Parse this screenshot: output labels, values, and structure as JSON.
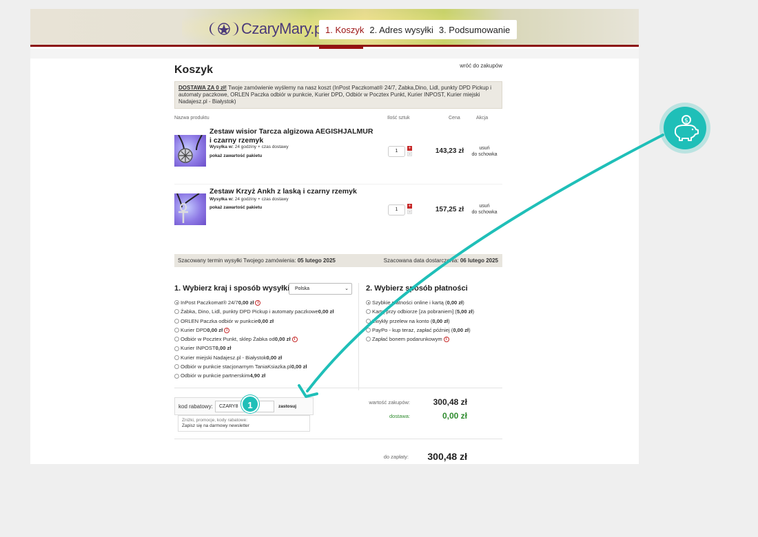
{
  "header": {
    "logo_text": "CzaryMary.pl",
    "steps": [
      "1. Koszyk",
      "2. Adres wysyłki",
      "3. Podsumowanie"
    ]
  },
  "cart": {
    "title": "Koszyk",
    "back_link": "wróć do zakupów",
    "shipping_note_bold": "DOSTAWA ZA 0 zł!",
    "shipping_note": " Twoje zamówienie wyślemy na nasz koszt (InPost Paczkomat® 24/7, Żabka,Dino, Lidl, punkty DPD Pickup i automaty paczkowe, ORLEN Paczka odbiór w punkcie, Kurier DPD, Odbiór w Pocztex Punkt, Kurier INPOST, Kurier miejski Nadajesz.pl - Białystok)",
    "columns": {
      "name": "Nazwa produktu",
      "qty": "Ilość sztuk",
      "price": "Cena",
      "action": "Akcja"
    },
    "items": [
      {
        "name": "Zestaw wisior Tarcza algizowa AEGISHJALMUR i czarny rzemyk",
        "ship_label": "Wysyłka w:",
        "ship_value": " 24 godziny + czas dostawy",
        "pack": "pokaż zawartość pakietu",
        "qty": "1",
        "price": "143,23 zł",
        "remove": "usuń",
        "save": "do schowka"
      },
      {
        "name": "Zestaw Krzyż Ankh z laską i czarny rzemyk",
        "ship_label": "Wysyłka w:",
        "ship_value": " 24 godziny + czas dostawy",
        "pack": "pokaż zawartość pakietu",
        "qty": "1",
        "price": "157,25 zł",
        "remove": "usuń",
        "save": "do schowka"
      }
    ],
    "dispatch_label": "Szacowany termin wysyłki Twojego zamówienia: ",
    "dispatch_date": "05 lutego 2025",
    "delivery_label": "Szacowana data dostarczenia: ",
    "delivery_date": "06 lutego 2025"
  },
  "shipping": {
    "title": "1. Wybierz kraj i sposób wysyłki",
    "country": "Polska",
    "options": [
      {
        "label": "InPost Paczkomat® 24/7 ",
        "price": "0,00 zł",
        "info": true,
        "checked": true
      },
      {
        "label": "Żabka, Dino, Lidl, punkty DPD Pickup i automaty paczkowe ",
        "price": "0,00 zł",
        "info": false,
        "checked": false
      },
      {
        "label": "ORLEN Paczka odbiór w punkcie ",
        "price": "0,00 zł",
        "info": false,
        "checked": false
      },
      {
        "label": "Kurier DPD ",
        "price": "0,00 zł",
        "info": true,
        "checked": false
      },
      {
        "label": "Odbiór w Pocztex Punkt, sklep Żabka od ",
        "price": "0,00 zł",
        "info": true,
        "checked": false
      },
      {
        "label": "Kurier INPOST ",
        "price": "0,00 zł",
        "info": false,
        "checked": false
      },
      {
        "label": "Kurier miejski Nadajesz.pl - Białystok ",
        "price": "0,00 zł",
        "info": false,
        "checked": false
      },
      {
        "label": "Odbiór w punkcie stacjonarnym TaniaKsiazka.pl ",
        "price": "0,00 zł",
        "info": false,
        "checked": false
      },
      {
        "label": "Odbiór w punkcie partnerskim ",
        "price": "4,90 zł",
        "info": false,
        "checked": false
      }
    ]
  },
  "payment": {
    "title": "2. Wybierz sposób płatności",
    "options": [
      {
        "label": "Szybkie płatności online i kartą (",
        "price": "0,00 zł",
        "suffix": ")",
        "info": false,
        "checked": true
      },
      {
        "label": "Kartą przy odbiorze [za pobraniem] (",
        "price": "5,00 zł",
        "suffix": ")",
        "info": false,
        "checked": false
      },
      {
        "label": "Zwykły przelew na konto (",
        "price": "0,00 zł",
        "suffix": ")",
        "info": false,
        "checked": false
      },
      {
        "label": "PayPo - kup teraz, zapłać później (",
        "price": "0,00 zł",
        "suffix": ")",
        "info": false,
        "checked": false
      },
      {
        "label": "Zapłać bonem podarunkowym ",
        "price": "",
        "suffix": "",
        "info": true,
        "checked": false
      }
    ]
  },
  "coupon": {
    "label": "kod rabatowy:",
    "value": "CZARY8",
    "apply": "zastosuj",
    "hint": "Zniżki, promocje, kody rabatowe:",
    "newsletter": "Zapisz się na darmowy newsletter"
  },
  "summary": {
    "subtotal_label": "wartość zakupów:",
    "subtotal": "300,48 zł",
    "delivery_label": "dostawa:",
    "delivery": "0,00 zł",
    "total_label": "do zapłaty:",
    "total": "300,48 zł"
  },
  "annotation": {
    "step_number": "1"
  },
  "colors": {
    "accent_red": "#9b1212",
    "teal": "#1fbfb8",
    "green": "#2e8b2e"
  }
}
